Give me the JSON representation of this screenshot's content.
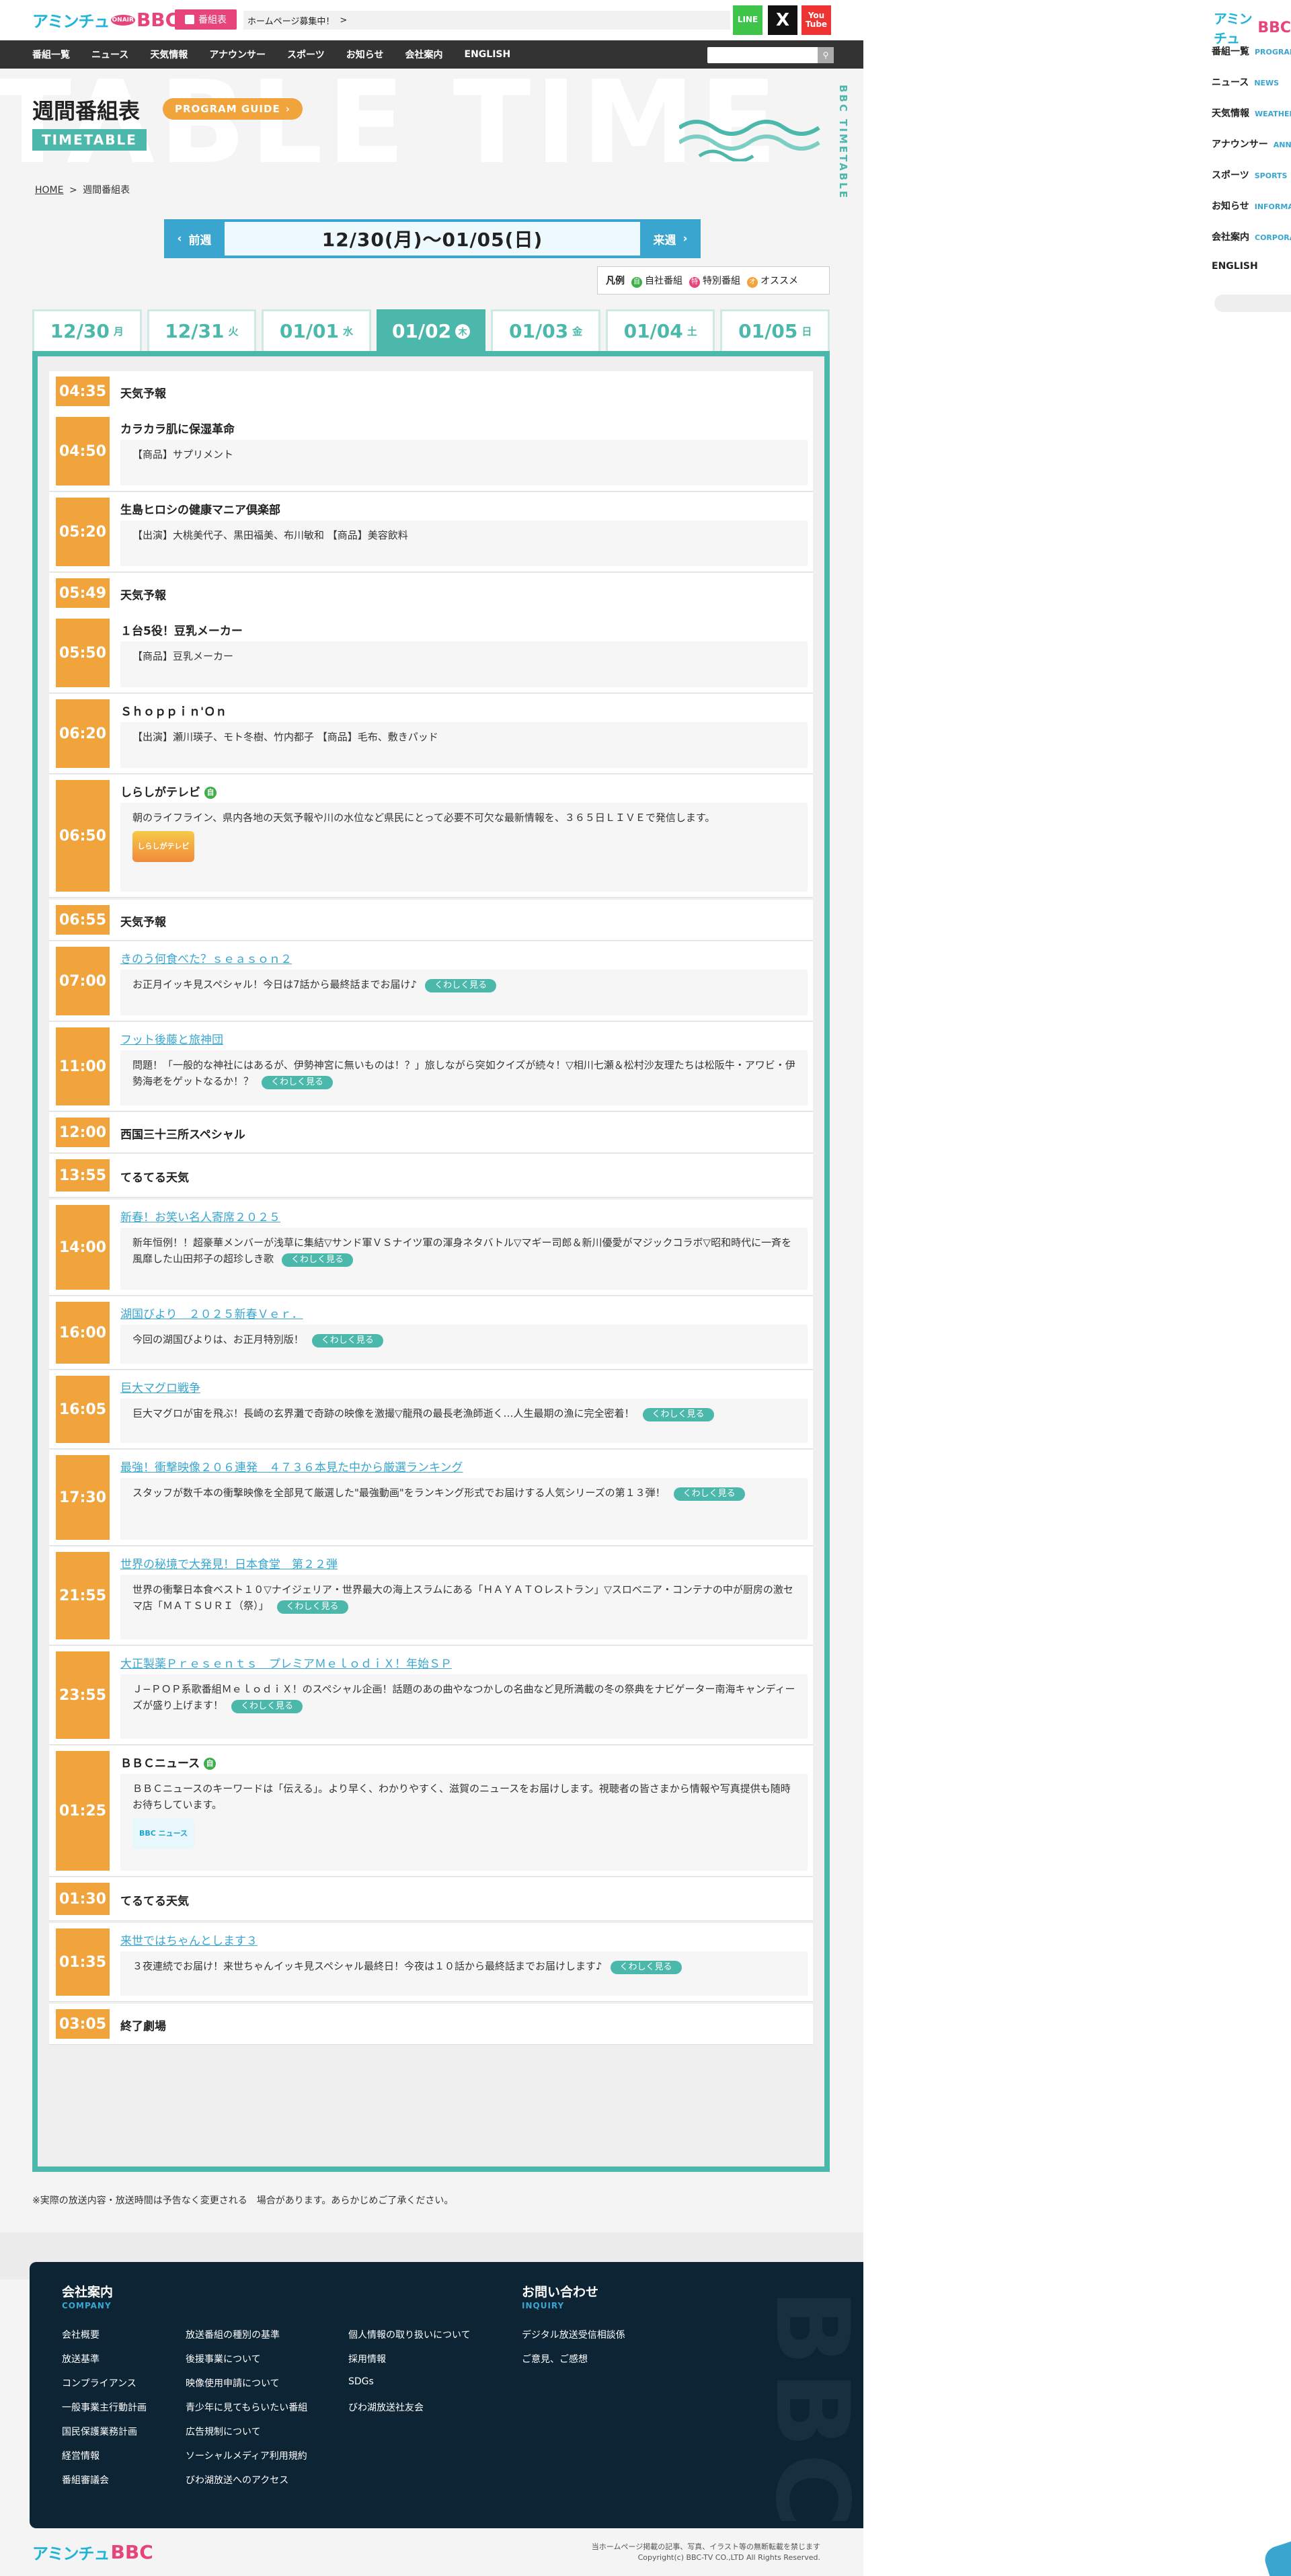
{
  "header": {
    "logo_ja": "アミンチュ",
    "logo_bbc": "BBC",
    "logo_badge": "ONAIR",
    "bangumi_button": "番組表",
    "ticker_text": "ホームページ募集中！",
    "ticker_arrow": ">",
    "line_label": "LINE",
    "x_label": "X",
    "youtube_label": "You Tube"
  },
  "nav": {
    "items": [
      "番組一覧",
      "ニュース",
      "天気情報",
      "アナウンサー",
      "スポーツ",
      "お知らせ",
      "会社案内",
      "ENGLISH"
    ]
  },
  "page": {
    "bg_word": "TABLE TIME",
    "title": "週間番組表",
    "guide_button": "PROGRAM GUIDE",
    "timetable_tag": "TIMETABLE",
    "vertical_label": "BBC TIMETABLE",
    "breadcrumb_home": "HOME",
    "breadcrumb_sep": ">",
    "breadcrumb_current": "週間番組表"
  },
  "week_nav": {
    "prev": "前週",
    "range": "12/30(月)〜01/05(日)",
    "next": "来週"
  },
  "legend": {
    "label": "凡例",
    "items": [
      {
        "mark": "自",
        "text": "自社番組",
        "color": "#3db04a"
      },
      {
        "mark": "特",
        "text": "特別番組",
        "color": "#e6447a"
      },
      {
        "mark": "オ",
        "text": "オススメ",
        "color": "#f0a43b"
      }
    ]
  },
  "tabs": [
    {
      "date": "12/30",
      "wd": "月",
      "active": false
    },
    {
      "date": "12/31",
      "wd": "火",
      "active": false
    },
    {
      "date": "01/01",
      "wd": "水",
      "active": false
    },
    {
      "date": "01/02",
      "wd": "木",
      "active": true
    },
    {
      "date": "01/03",
      "wd": "金",
      "active": false
    },
    {
      "date": "01/04",
      "wd": "土",
      "active": false
    },
    {
      "date": "01/05",
      "wd": "日",
      "active": false
    }
  ],
  "programs": [
    {
      "time": "04:35",
      "title": "天気予報"
    },
    {
      "time": "04:50",
      "title": "カラカラ肌に保湿革命",
      "desc": "【商品】サプリメント"
    },
    {
      "time": "05:20",
      "title": "生島ヒロシの健康マニア倶楽部",
      "desc": "【出演】大桃美代子、黒田福美、布川敏和 【商品】美容飲料"
    },
    {
      "time": "05:49",
      "title": "天気予報"
    },
    {
      "time": "05:50",
      "title": "１台5役！豆乳メーカー",
      "desc": "【商品】豆乳メーカー"
    },
    {
      "time": "06:20",
      "title": "Ｓｈｏｐｐｉｎ'Ｏｎ",
      "desc": "【出演】瀬川瑛子、モト冬樹、竹内都子 【商品】毛布、敷きパッド"
    },
    {
      "time": "06:50",
      "title": "しらしがテレビ",
      "new_mark": "自",
      "desc": "朝のライフライン、県内各地の天気予報や川の水位など県民にとって必要不可欠な最新情報を、３６５日ＬＩＶＥで発信します。",
      "logo": "しらしがテレビ"
    },
    {
      "time": "06:55",
      "title": "天気予報"
    },
    {
      "time": "07:00",
      "title": "きのう何食べた？ｓｅａｓｏｎ２",
      "desc": "お正月イッキ見スペシャル！今日は7話から最終話までお届け♪"
    },
    {
      "time": "11:00",
      "title": "フット後藤と旅神団",
      "desc": "問題！「一般的な神社にはあるが、伊勢神宮に無いものは！？」旅しながら突如クイズが続々！▽相川七瀬＆松村沙友理たちは松阪牛・アワビ・伊勢海老をゲットなるか！？"
    },
    {
      "time": "12:00",
      "title": "西国三十三所スペシャル"
    },
    {
      "time": "13:55",
      "title": "てるてる天気"
    },
    {
      "time": "14:00",
      "title": "新春！お笑い名人寄席２０２５",
      "desc": "新年恒例！！超豪華メンバーが浅草に集結▽サンド軍ＶＳナイツ軍の渾身ネタバトル▽マギー司郎＆新川優愛がマジックコラボ▽昭和時代に一斉を風靡した山田邦子の超珍しき歌"
    },
    {
      "time": "16:00",
      "title": "湖国びより　２０２５新春Ｖｅｒ．",
      "desc": "今回の湖国びよりは、お正月特別版！"
    },
    {
      "time": "16:05",
      "title": "巨大マグロ戦争",
      "desc": "巨大マグロが宙を飛ぶ！長崎の玄界灘で奇跡の映像を激撮▽龍飛の最長老漁師逝く…人生最期の漁に完全密着！"
    },
    {
      "time": "17:30",
      "title": "最強！衝撃映像２０６連発　４７３６本見た中から厳選ランキング",
      "desc": "スタッフが数千本の衝撃映像を全部見て厳選した\"最強動画\"をランキング形式でお届けする人気シリーズの第１３弾！"
    },
    {
      "time": "21:55",
      "title": "世界の秘境で大発見！日本食堂　第２２弾",
      "desc": "世界の衝撃日本食ベスト１０▽ナイジェリア・世界最大の海上スラムにある「ＨＡＹＡＴＯレストラン」▽スロベニア・コンテナの中が厨房の激セマ店「ＭＡＴＳＵＲＩ（祭）」"
    },
    {
      "time": "23:55",
      "title": "大正製薬Ｐｒｅｓｅｎｔｓ　プレミアＭｅｌｏｄｉＸ！年始ＳＰ",
      "desc": "Ｊ−ＰＯＰ系歌番組ＭｅｌｏｄｉＸ！のスペシャル企画！話題のあの曲やなつかしの名曲など見所満載の冬の祭典をナビゲーター南海キャンディーズが盛り上げます！"
    },
    {
      "time": "01:25",
      "title": "ＢＢＣニュース",
      "new_mark": "自",
      "desc": "ＢＢＣニュースのキーワードは「伝える」。より早く、わかりやすく、滋賀のニュースをお届けします。視聴者の皆さまから情報や写真提供も随時お待ちしています。",
      "logo": "BBC ニュース"
    },
    {
      "time": "01:30",
      "title": "てるてる天気"
    },
    {
      "time": "01:35",
      "title": "来世ではちゃんとします３",
      "desc": "３夜連続でお届け！来世ちゃんイッキ見スペシャル最終日！今夜は１０話から最終話までお届けします♪"
    },
    {
      "time": "03:05",
      "title": "終了劇場"
    }
  ],
  "more_label": "くわしく見る",
  "notice": "※実際の放送内容・放送時間は予告なく変更される　場合があります。あらかじめご了承ください。",
  "footer": {
    "ghost": "BBC",
    "company_title": "会社案内",
    "company_sub": "COMPANY",
    "inquiry_title": "お問い合わせ",
    "inquiry_sub": "INQUIRY",
    "col1": [
      "会社概要",
      "放送基準",
      "コンプライアンス",
      "一般事業主行動計画",
      "国民保護業務計画",
      "経営情報",
      "番組審議会"
    ],
    "col2": [
      "放送番組の種別の基準",
      "後援事業について",
      "映像使用申請について",
      "青少年に見てもらいたい番組",
      "広告規制について",
      "ソーシャルメディア利用規約",
      "びわ湖放送へのアクセス"
    ],
    "col3": [
      "個人情報の取り扱いについて",
      "採用情報",
      "SDGs",
      "びわ湖放送社友会"
    ],
    "col4": [
      "デジタル放送受信相談係",
      "ご意見、ご感想"
    ],
    "copy1": "当ホームページ掲載の記事、写真、イラスト等の無断転載を禁じます",
    "copy2": "Copyright(c) BBC-TV CO.,LTD All Rights Reserved."
  },
  "side": {
    "items": [
      {
        "ja": "番組一覧",
        "en": "PROGRAM"
      },
      {
        "ja": "ニュース",
        "en": "NEWS"
      },
      {
        "ja": "天気情報",
        "en": "WEATHER"
      },
      {
        "ja": "アナウンサー",
        "en": "ANNOUNCER"
      },
      {
        "ja": "スポーツ",
        "en": "SPORTS"
      },
      {
        "ja": "お知らせ",
        "en": "INFORMATION"
      },
      {
        "ja": "会社案内",
        "en": "CORPORATE"
      },
      {
        "ja": "ENGLISH",
        "en": ""
      }
    ]
  }
}
